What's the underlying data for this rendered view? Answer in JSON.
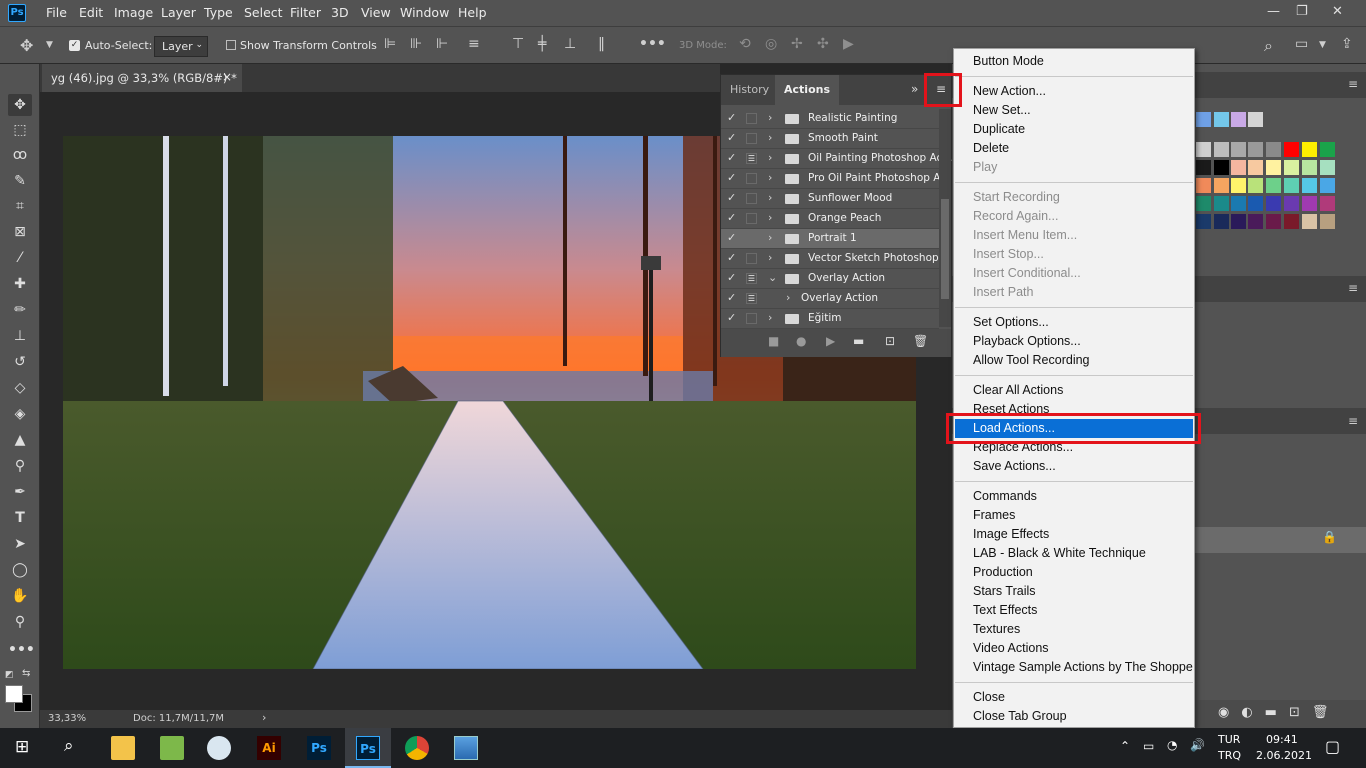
{
  "menubar": [
    "File",
    "Edit",
    "Image",
    "Layer",
    "Type",
    "Select",
    "Filter",
    "3D",
    "View",
    "Window",
    "Help"
  ],
  "options": {
    "auto_select_label": "Auto-Select:",
    "auto_select_value": "Layer",
    "transform_label": "Show Transform Controls",
    "mode3d": "3D Mode:"
  },
  "doc_tab": {
    "title": "yg (46).jpg @ 33,3% (RGB/8#) *",
    "close": "×"
  },
  "status": {
    "zoom": "33,33%",
    "doc": "Doc: 11,7M/11,7M"
  },
  "actions_panel": {
    "tabs": [
      "History",
      "Actions"
    ],
    "rows": [
      {
        "label": "Realistic Painting",
        "check": "✓",
        "toggle": "",
        "chev": "›"
      },
      {
        "label": "Smooth Paint",
        "check": "✓",
        "toggle": "",
        "chev": "›"
      },
      {
        "label": "Oil Painting Photoshop Ac...",
        "check": "✓",
        "toggle": "☰",
        "chev": "›"
      },
      {
        "label": "Pro Oil Paint Photoshop A...",
        "check": "✓",
        "toggle": "",
        "chev": "›"
      },
      {
        "label": "Sunflower Mood",
        "check": "✓",
        "toggle": "",
        "chev": "›"
      },
      {
        "label": "Orange Peach",
        "check": "✓",
        "toggle": "",
        "chev": "›"
      },
      {
        "label": "Portrait 1",
        "check": "✓",
        "toggle": "",
        "chev": "›"
      },
      {
        "label": "Vector Sketch Photoshop ...",
        "check": "✓",
        "toggle": "",
        "chev": "›"
      },
      {
        "label": "Overlay Action",
        "check": "✓",
        "toggle": "☰",
        "chev": "⌄"
      },
      {
        "label": "Overlay Action",
        "check": "✓",
        "toggle": "☰",
        "chev": "›"
      },
      {
        "label": "Eğitim",
        "check": "✓",
        "toggle": "",
        "chev": "›"
      }
    ]
  },
  "flyout": {
    "items": [
      {
        "label": "Button Mode",
        "state": "enabled"
      },
      {
        "sep": true
      },
      {
        "label": "New Action...",
        "state": "enabled"
      },
      {
        "label": "New Set...",
        "state": "enabled"
      },
      {
        "label": "Duplicate",
        "state": "enabled"
      },
      {
        "label": "Delete",
        "state": "enabled"
      },
      {
        "label": "Play",
        "state": "disabled"
      },
      {
        "sep": true
      },
      {
        "label": "Start Recording",
        "state": "disabled"
      },
      {
        "label": "Record Again...",
        "state": "disabled"
      },
      {
        "label": "Insert Menu Item...",
        "state": "disabled"
      },
      {
        "label": "Insert Stop...",
        "state": "disabled"
      },
      {
        "label": "Insert Conditional...",
        "state": "disabled"
      },
      {
        "label": "Insert Path",
        "state": "disabled"
      },
      {
        "sep": true
      },
      {
        "label": "Set Options...",
        "state": "enabled"
      },
      {
        "label": "Playback Options...",
        "state": "enabled"
      },
      {
        "label": "Allow Tool Recording",
        "state": "enabled"
      },
      {
        "sep": true
      },
      {
        "label": "Clear All Actions",
        "state": "enabled"
      },
      {
        "label": "Reset Actions",
        "state": "enabled"
      },
      {
        "label": "Load Actions...",
        "state": "highlighted"
      },
      {
        "label": "Replace Actions...",
        "state": "enabled"
      },
      {
        "label": "Save Actions...",
        "state": "enabled"
      },
      {
        "sep": true
      },
      {
        "label": "Commands",
        "state": "enabled"
      },
      {
        "label": "Frames",
        "state": "enabled"
      },
      {
        "label": "Image Effects",
        "state": "enabled"
      },
      {
        "label": "LAB - Black & White Technique",
        "state": "enabled"
      },
      {
        "label": "Production",
        "state": "enabled"
      },
      {
        "label": "Stars Trails",
        "state": "enabled"
      },
      {
        "label": "Text Effects",
        "state": "enabled"
      },
      {
        "label": "Textures",
        "state": "enabled"
      },
      {
        "label": "Video Actions",
        "state": "enabled"
      },
      {
        "label": "Vintage Sample Actions by The Shoppe",
        "state": "enabled"
      },
      {
        "sep": true
      },
      {
        "label": "Close",
        "state": "enabled"
      },
      {
        "label": "Close Tab Group",
        "state": "enabled"
      }
    ]
  },
  "taskbar": {
    "lang1": "TUR",
    "lang2": "TRQ",
    "time": "09:41",
    "date": "2.06.2021"
  },
  "colors": {
    "accent": "#0a6fd6",
    "highlight_box": "#e3131b",
    "ps_blue": "#31a8ff"
  }
}
